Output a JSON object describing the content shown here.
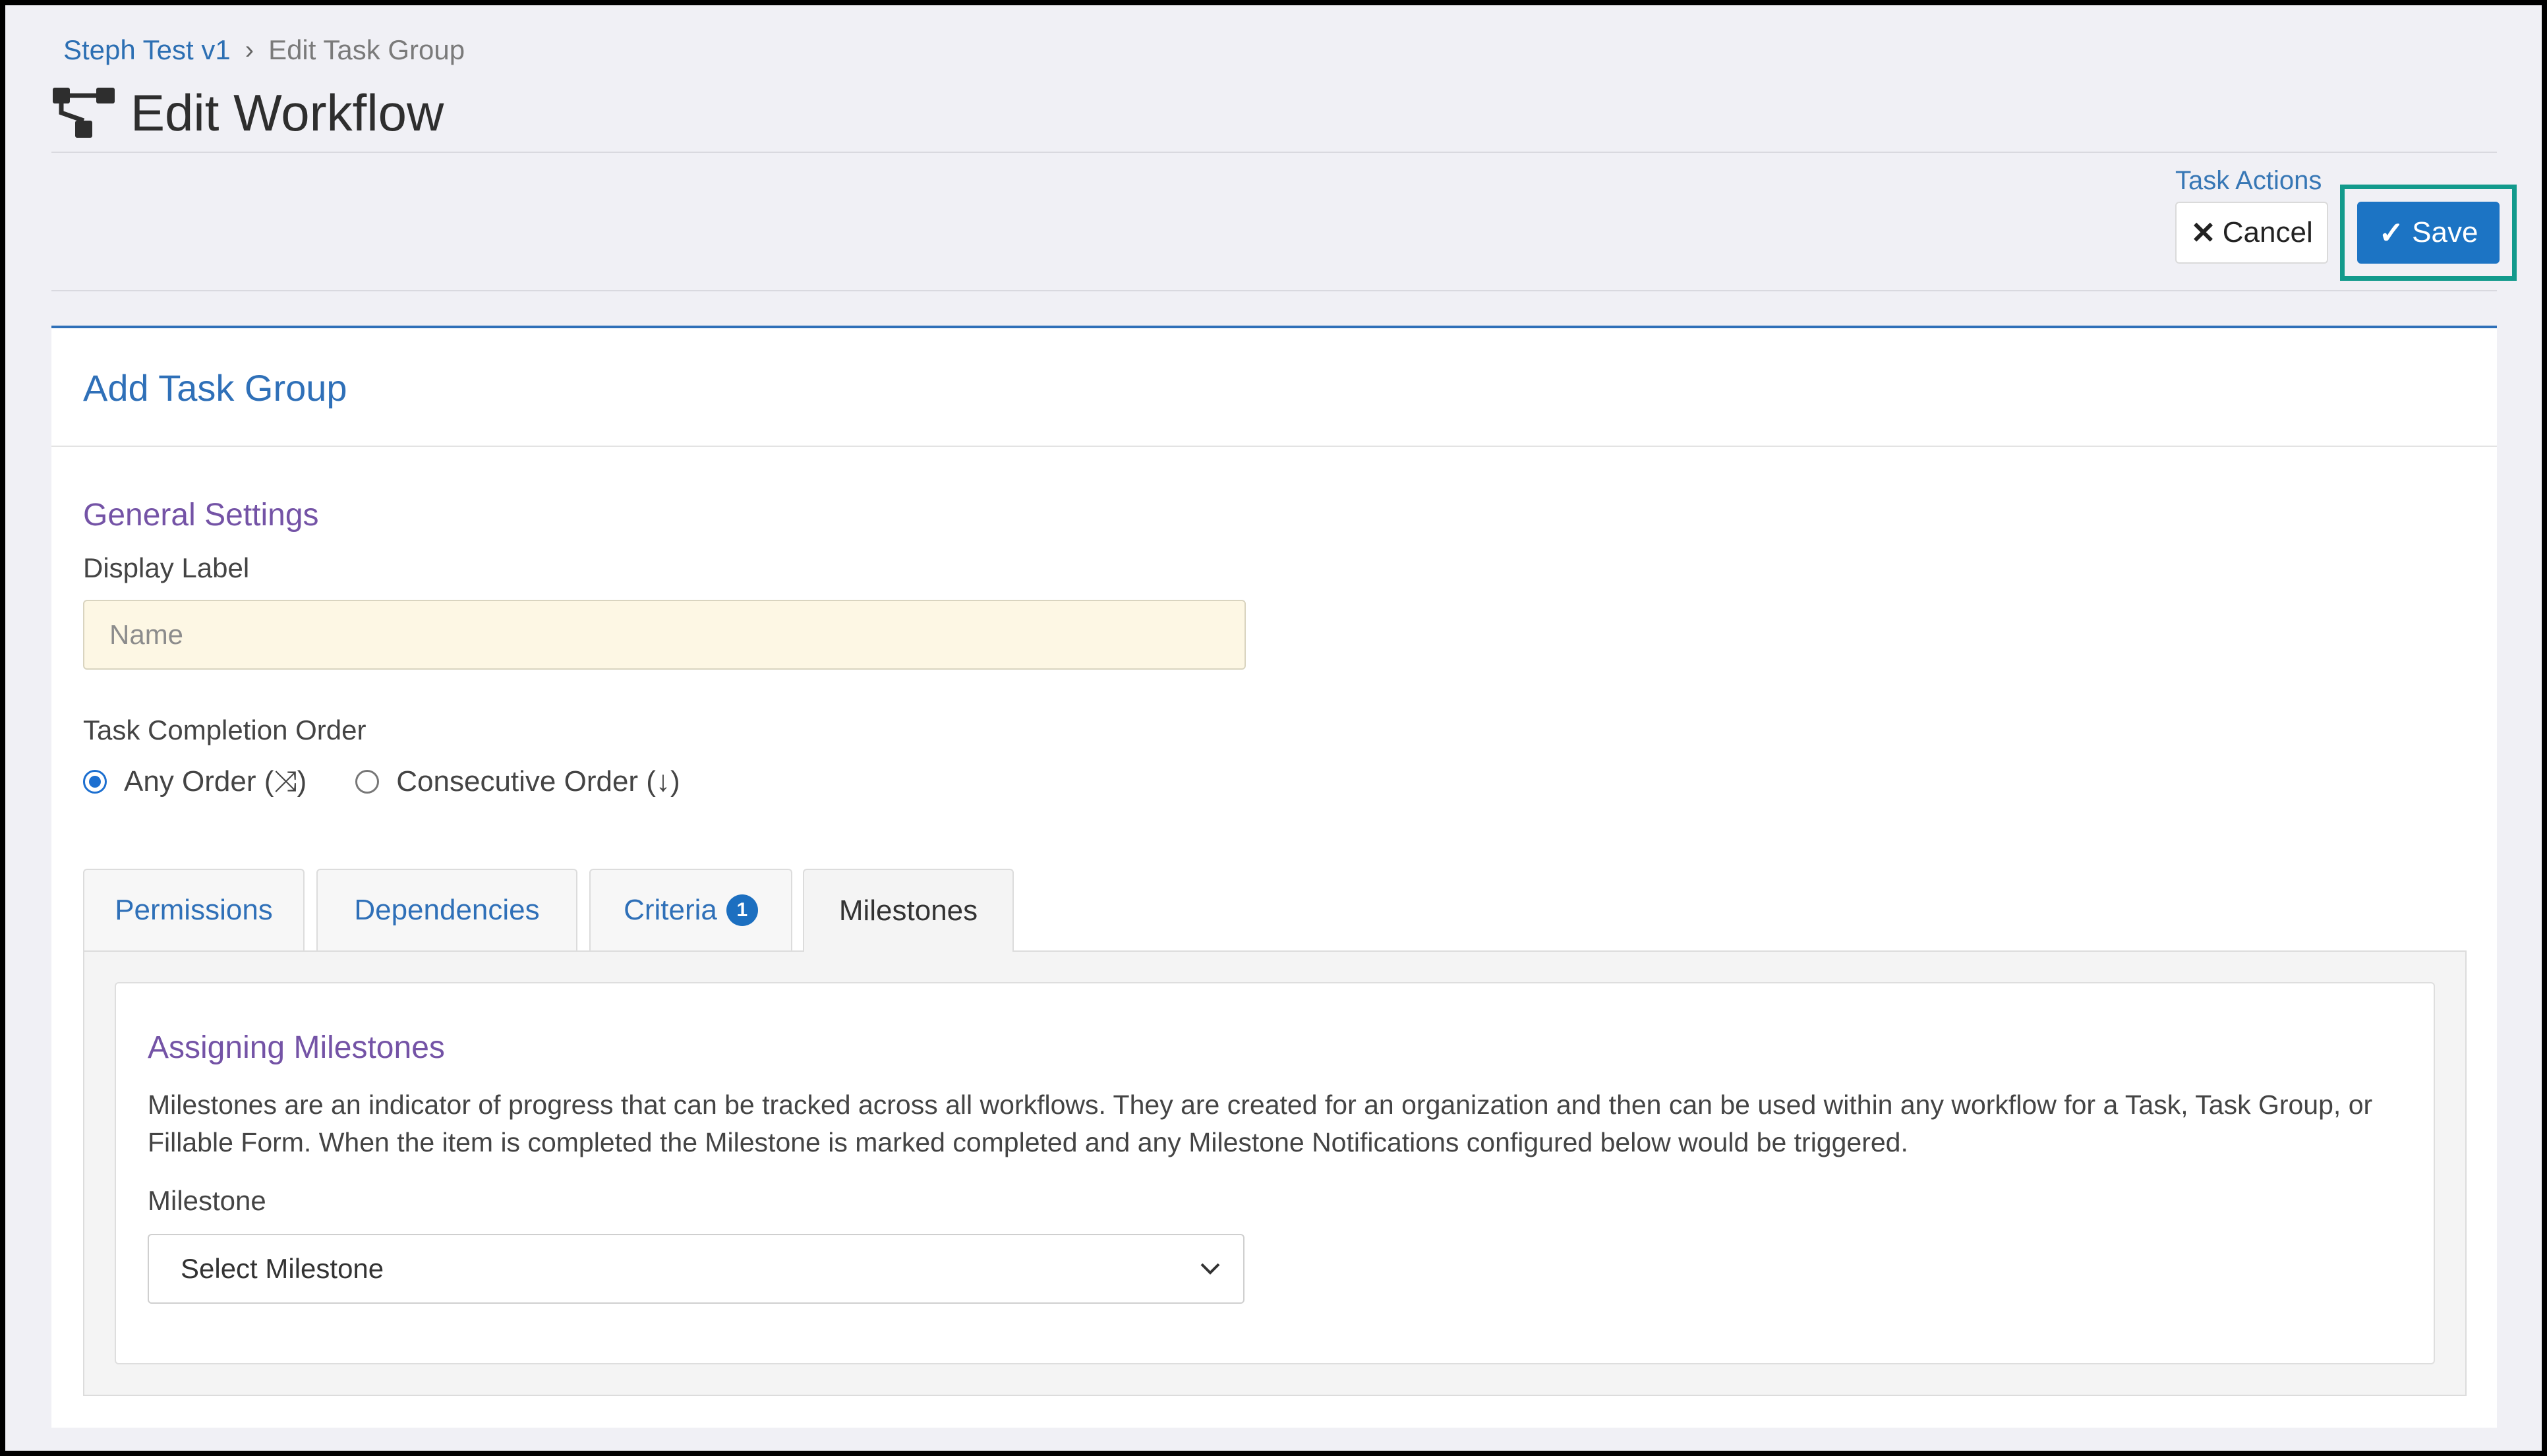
{
  "breadcrumb": {
    "parent": "Steph Test v1",
    "current": "Edit Task Group"
  },
  "page": {
    "title": "Edit Workflow",
    "icon": "workflow-icon"
  },
  "actions": {
    "label": "Task Actions",
    "cancel_label": "Cancel",
    "save_label": "Save",
    "highlight_color": "#129a8c"
  },
  "card": {
    "title": "Add Task Group",
    "accent": "#2f70b8"
  },
  "general": {
    "title": "General Settings",
    "display_label": "Display Label",
    "name_placeholder": "Name",
    "name_value": ""
  },
  "completion": {
    "label": "Task Completion Order",
    "options": [
      {
        "label": "Any Order (⤨)",
        "checked": true
      },
      {
        "label": "Consecutive Order (↓)",
        "checked": false
      }
    ]
  },
  "tabs": [
    {
      "label": "Permissions",
      "active": false
    },
    {
      "label": "Dependencies",
      "active": false
    },
    {
      "label": "Criteria",
      "badge": "1",
      "active": false
    },
    {
      "label": "Milestones",
      "active": true
    }
  ],
  "milestones": {
    "title": "Assigning Milestones",
    "description": "Milestones are an indicator of progress that can be tracked across all workflows. They are created for an organization and then can be used within any workflow for a Task, Task Group, or Fillable Form. When the item is completed the Milestone is marked completed and any Milestone Notifications configured below would be triggered.",
    "field_label": "Milestone",
    "select_value": "Select Milestone"
  }
}
